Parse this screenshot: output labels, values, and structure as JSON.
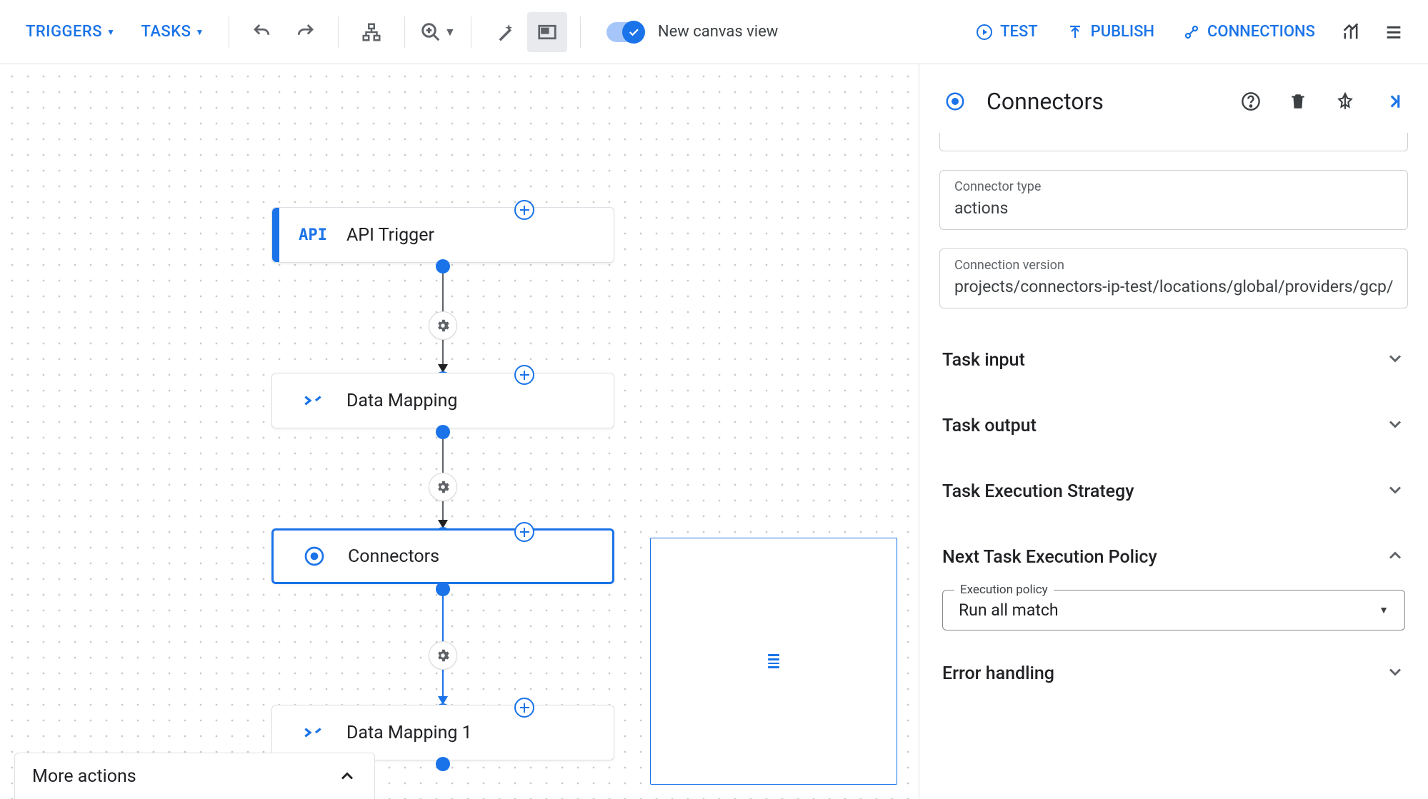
{
  "toolbar": {
    "triggers_label": "TRIGGERS",
    "tasks_label": "TASKS",
    "toggle_label": "New canvas view",
    "test_label": "TEST",
    "publish_label": "PUBLISH",
    "connections_label": "CONNECTIONS"
  },
  "canvas": {
    "nodes": {
      "api_trigger": "API Trigger",
      "data_mapping": "Data Mapping",
      "connectors": "Connectors",
      "data_mapping_1": "Data Mapping 1",
      "api_icon_text": "API"
    },
    "more_actions": "More actions"
  },
  "panel": {
    "title": "Connectors",
    "connector_type_label": "Connector type",
    "connector_type_value": "actions",
    "connection_version_label": "Connection version",
    "connection_version_value": "projects/connectors-ip-test/locations/global/providers/gcp/co",
    "sections": {
      "task_input": "Task input",
      "task_output": "Task output",
      "task_strategy": "Task Execution Strategy",
      "next_policy": "Next Task Execution Policy",
      "error_handling": "Error handling"
    },
    "policy_label": "Execution policy",
    "policy_value": "Run all match"
  }
}
